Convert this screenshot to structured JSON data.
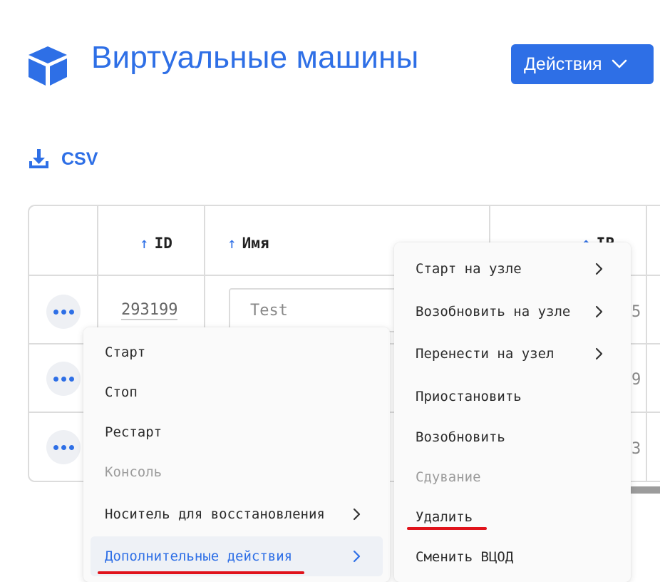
{
  "header": {
    "title": "Виртуальные машины",
    "actions_label": "Действия",
    "icon": "cube-icon",
    "accent_color": "#2e6fe6"
  },
  "toolbar": {
    "csv_label": "CSV",
    "csv_icon": "download-icon"
  },
  "table": {
    "columns": [
      {
        "label": "ID",
        "sort": "asc"
      },
      {
        "label": "Имя",
        "sort": "asc"
      },
      {
        "label": "IP",
        "sort": "asc"
      }
    ],
    "rows": [
      {
        "id": "293199",
        "name": "Test"
      },
      {
        "id": "",
        "name": ""
      },
      {
        "id": "",
        "name": ""
      }
    ]
  },
  "context_menu": {
    "items": [
      {
        "label": "Старт",
        "disabled": false,
        "submenu": false
      },
      {
        "label": "Стоп",
        "disabled": false,
        "submenu": false
      },
      {
        "label": "Рестарт",
        "disabled": false,
        "submenu": false
      },
      {
        "label": "Консоль",
        "disabled": true,
        "submenu": false
      },
      {
        "label": "Носитель для восстановления",
        "disabled": false,
        "submenu": true
      },
      {
        "label": "Дополнительные действия",
        "disabled": false,
        "submenu": true,
        "active": true
      }
    ]
  },
  "submenu": {
    "items": [
      {
        "label": "Старт на узле",
        "disabled": false,
        "submenu": true
      },
      {
        "label": "Возобновить на узле",
        "disabled": false,
        "submenu": true
      },
      {
        "label": "Перенести на узел",
        "disabled": false,
        "submenu": true
      },
      {
        "label": "Приостановить",
        "disabled": false,
        "submenu": false
      },
      {
        "label": "Возобновить",
        "disabled": false,
        "submenu": false
      },
      {
        "label": "Сдувание",
        "disabled": true,
        "submenu": false
      },
      {
        "label": "Удалить",
        "disabled": false,
        "submenu": false,
        "highlighted": true
      },
      {
        "label": "Сменить ВЦОД",
        "disabled": false,
        "submenu": false
      }
    ]
  },
  "highlight_color": "#e0131b"
}
